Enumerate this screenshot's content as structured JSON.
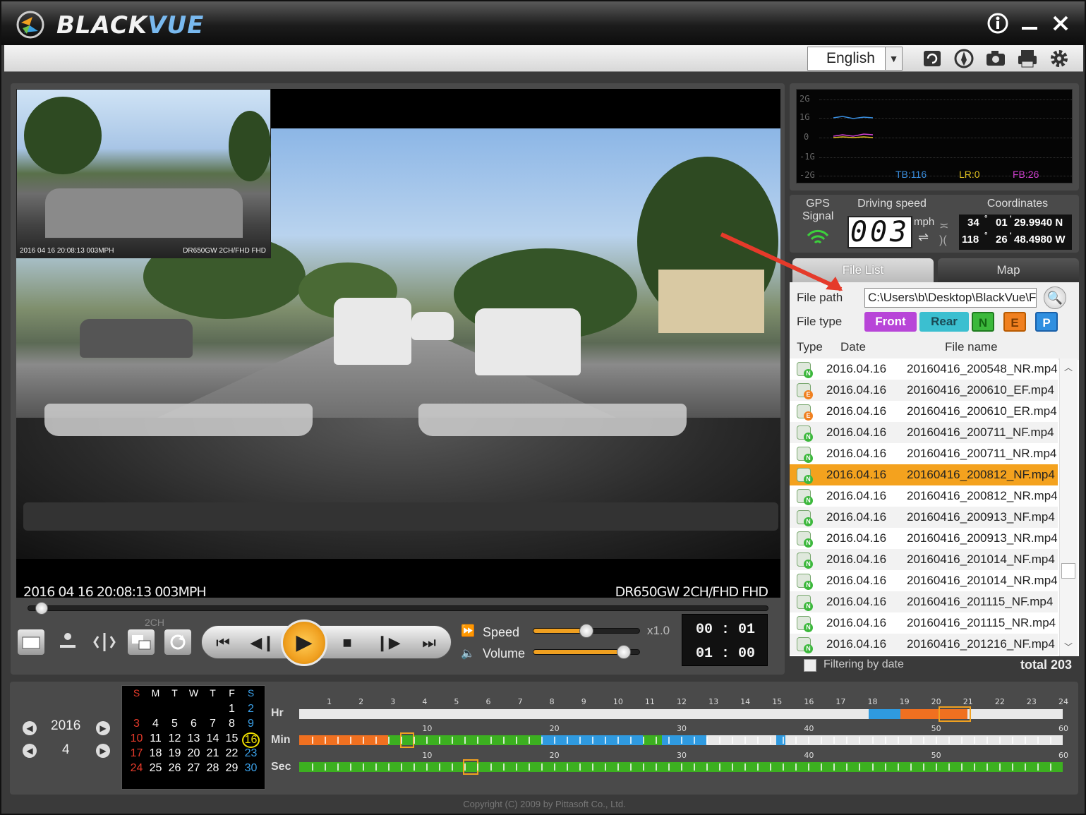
{
  "app": {
    "brand_black": "BLACK",
    "brand_vue": "VUE",
    "language": "English"
  },
  "toolbar_icons": [
    "refresh-icon",
    "map-pin-icon",
    "camera-icon",
    "print-icon",
    "gear-icon"
  ],
  "video": {
    "overlay_left": "2016 04 16  20:08:13    003MPH",
    "overlay_right": "DR650GW 2CH/FHD FHD",
    "rear_overlay_left": "2016 04 16  20:08:13  003MPH",
    "rear_overlay_right": "DR650GW 2CH/FHD FHD",
    "seek_progress": 0.01
  },
  "controls": {
    "ch_label": "2CH",
    "speed_label": "Speed",
    "volume_label": "Volume",
    "speed_value": "x1.0",
    "speed_level": 0.5,
    "volume_level": 0.85,
    "current_time": "00 : 01",
    "total_time": "01 : 00"
  },
  "gsensor": {
    "labels": [
      "2G",
      "1G",
      "0",
      "-1G",
      "-2G"
    ],
    "tb": "TB:116",
    "lr": "LR:0",
    "fb": "FB:26",
    "tb_color": "#3a8fe0",
    "lr_color": "#e0c020",
    "fb_color": "#d040d0"
  },
  "gps": {
    "signal_label_1": "GPS",
    "signal_label_2": "Signal",
    "driving_speed_label": "Driving speed",
    "speed": "003",
    "unit": "mph",
    "coordinates_label": "Coordinates",
    "lat_deg": "34",
    "lat_min": "01",
    "lat_sec": "29.9940 N",
    "lon_deg": "118",
    "lon_min": "26",
    "lon_sec": "48.4980 W"
  },
  "tabs": {
    "file_list": "File List",
    "map": "Map"
  },
  "file_list": {
    "path_label": "File path",
    "path_value": "C:\\Users\\b\\Desktop\\BlackVue\\F",
    "type_label": "File type",
    "front": "Front",
    "rear": "Rear",
    "n": "N",
    "e": "E",
    "p": "P",
    "front_color": "#b845d8",
    "rear_color": "#3bbfd0",
    "n_color": "#3cb83c",
    "e_color": "#f08020",
    "p_color": "#2f8fe0",
    "col_type": "Type",
    "col_date": "Date",
    "col_name": "File name",
    "rows": [
      {
        "type": "N",
        "date": "2016.04.16",
        "name": "20160416_200548_NR.mp4"
      },
      {
        "type": "E",
        "date": "2016.04.16",
        "name": "20160416_200610_EF.mp4"
      },
      {
        "type": "E",
        "date": "2016.04.16",
        "name": "20160416_200610_ER.mp4"
      },
      {
        "type": "N",
        "date": "2016.04.16",
        "name": "20160416_200711_NF.mp4"
      },
      {
        "type": "N",
        "date": "2016.04.16",
        "name": "20160416_200711_NR.mp4"
      },
      {
        "type": "N",
        "date": "2016.04.16",
        "name": "20160416_200812_NF.mp4",
        "selected": true
      },
      {
        "type": "N",
        "date": "2016.04.16",
        "name": "20160416_200812_NR.mp4"
      },
      {
        "type": "N",
        "date": "2016.04.16",
        "name": "20160416_200913_NF.mp4"
      },
      {
        "type": "N",
        "date": "2016.04.16",
        "name": "20160416_200913_NR.mp4"
      },
      {
        "type": "N",
        "date": "2016.04.16",
        "name": "20160416_201014_NF.mp4"
      },
      {
        "type": "N",
        "date": "2016.04.16",
        "name": "20160416_201014_NR.mp4"
      },
      {
        "type": "N",
        "date": "2016.04.16",
        "name": "20160416_201115_NF.mp4"
      },
      {
        "type": "N",
        "date": "2016.04.16",
        "name": "20160416_201115_NR.mp4"
      },
      {
        "type": "N",
        "date": "2016.04.16",
        "name": "20160416_201216_NF.mp4"
      }
    ],
    "filter_label": "Filtering by date",
    "total": "total 203"
  },
  "calendar": {
    "year": "2016",
    "month": "4",
    "weekdays": [
      "S",
      "M",
      "T",
      "W",
      "T",
      "F",
      "S"
    ],
    "weeks": [
      [
        "",
        "",
        "",
        "",
        "",
        "1",
        "2"
      ],
      [
        "3",
        "4",
        "5",
        "6",
        "7",
        "8",
        "9"
      ],
      [
        "10",
        "11",
        "12",
        "13",
        "14",
        "15",
        "16"
      ],
      [
        "17",
        "18",
        "19",
        "20",
        "21",
        "22",
        "23"
      ],
      [
        "24",
        "25",
        "26",
        "27",
        "28",
        "29",
        "30"
      ]
    ],
    "selected_day": "16"
  },
  "timeline": {
    "hr_label": "Hr",
    "min_label": "Min",
    "sec_label": "Sec",
    "hr_ticks": [
      "1",
      "2",
      "3",
      "4",
      "5",
      "6",
      "7",
      "8",
      "9",
      "10",
      "11",
      "12",
      "13",
      "14",
      "15",
      "16",
      "17",
      "18",
      "19",
      "20",
      "21",
      "22",
      "23",
      "24"
    ],
    "ms_ticks": [
      "10",
      "20",
      "30",
      "40",
      "50",
      "60"
    ]
  },
  "copyright": "Copyright (C) 2009 by Pittasoft Co., Ltd."
}
